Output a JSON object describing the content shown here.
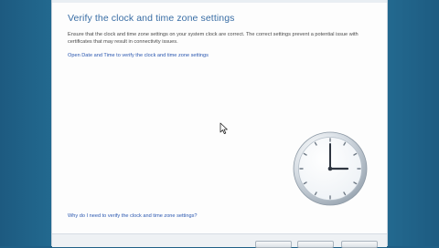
{
  "dialog": {
    "title": "Verify the clock and time zone settings",
    "description": "Ensure that the clock and time zone settings on your system clock are correct. The correct settings prevent a potential issue with certificates that may result in connectivity issues.",
    "open_link": "Open Date and Time to verify the clock and time zone settings",
    "help_link": "Why do I need to verify the clock and time zone settings?"
  },
  "icons": {
    "clock": "clock-icon",
    "cursor": "mouse-pointer-icon"
  },
  "colors": {
    "background": "#1f5f86",
    "title": "#3a6ea5",
    "link": "#2a57b0"
  }
}
